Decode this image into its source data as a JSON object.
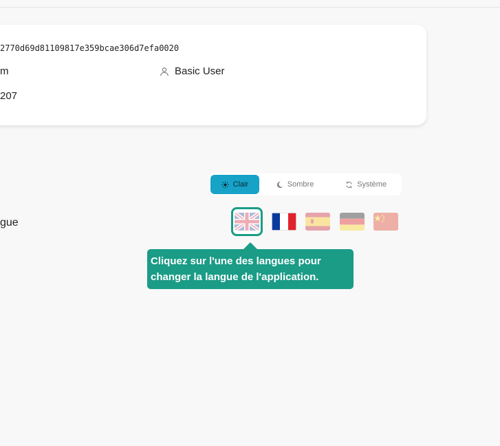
{
  "user_info": {
    "id_fragment": "2770d69d81109817e359bcae306d7efa0020",
    "field_fragment_1": "m",
    "field_fragment_2": "207",
    "role_label": "Basic User",
    "role_icon": "user-icon"
  },
  "theme": {
    "options": [
      {
        "label": "Clair",
        "icon": "sun-icon",
        "active": true
      },
      {
        "label": "Sombre",
        "icon": "moon-icon",
        "active": false
      },
      {
        "label": "Système",
        "icon": "sync-icon",
        "active": false
      }
    ],
    "active_color": "#17a2c8"
  },
  "language": {
    "label_fragment": "gue",
    "flags": [
      {
        "name": "uk-flag-icon",
        "selected": true
      },
      {
        "name": "france-flag-icon",
        "selected": false
      },
      {
        "name": "spain-flag-icon",
        "selected": false
      },
      {
        "name": "germany-flag-icon",
        "selected": false
      },
      {
        "name": "china-flag-icon",
        "selected": false
      }
    ]
  },
  "tooltip": {
    "line1": "Cliquez sur l'une des langues pour",
    "line2": "changer la langue de l'application.",
    "color": "#1a9c86"
  }
}
